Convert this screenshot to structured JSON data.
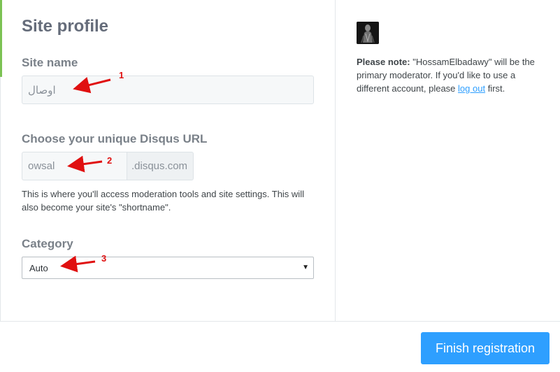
{
  "profile": {
    "title": "Site profile",
    "site_name_label": "Site name",
    "site_name_value": "اوصال",
    "url_label": "Choose your unique Disqus URL",
    "url_value": "owsal",
    "url_suffix": ".disqus.com",
    "url_help": "This is where you'll access moderation tools and site settings. This will also become your site's \"shortname\".",
    "category_label": "Category",
    "category_value": "Auto"
  },
  "sidebar": {
    "avatar_icon": "user-avatar-icon",
    "note_prefix": "Please note:",
    "note_body": " \"HossamElbadawy\" will be the primary moderator. If you'd like to use a different account, please ",
    "note_link": "log out",
    "note_suffix": " first."
  },
  "footer": {
    "finish_label": "Finish registration"
  },
  "annotations": [
    "1",
    "2",
    "3"
  ],
  "colors": {
    "accent": "#7cc254",
    "primary_button": "#2e9fff",
    "annotation": "#e01010"
  }
}
